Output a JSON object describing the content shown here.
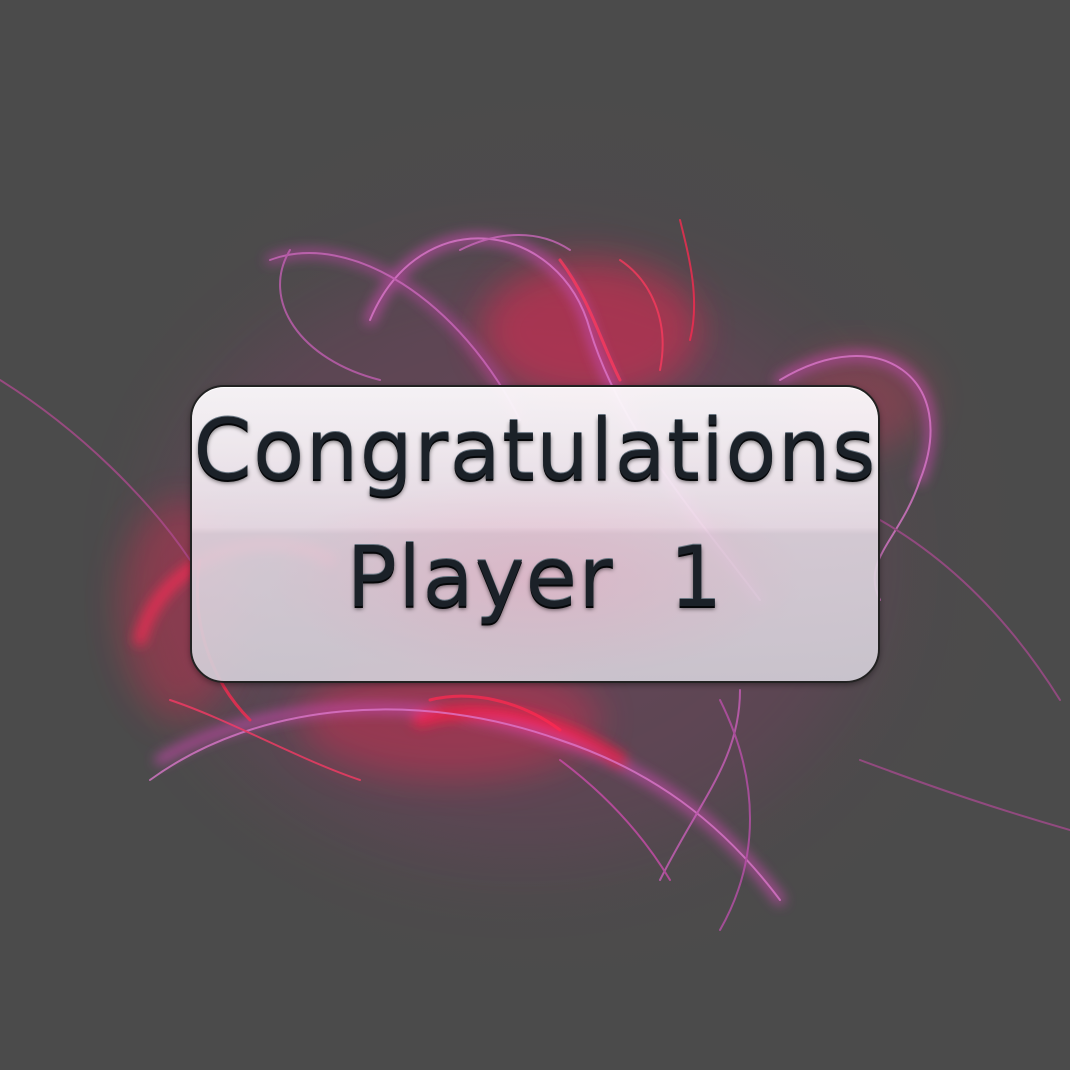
{
  "message": {
    "line1": "Congratulations",
    "line2": "Player  1"
  },
  "colors": {
    "background": "#4b4b4b",
    "glow_red": "#ff1a4a",
    "glow_magenta": "#c040b0",
    "text": "#1b2128"
  }
}
